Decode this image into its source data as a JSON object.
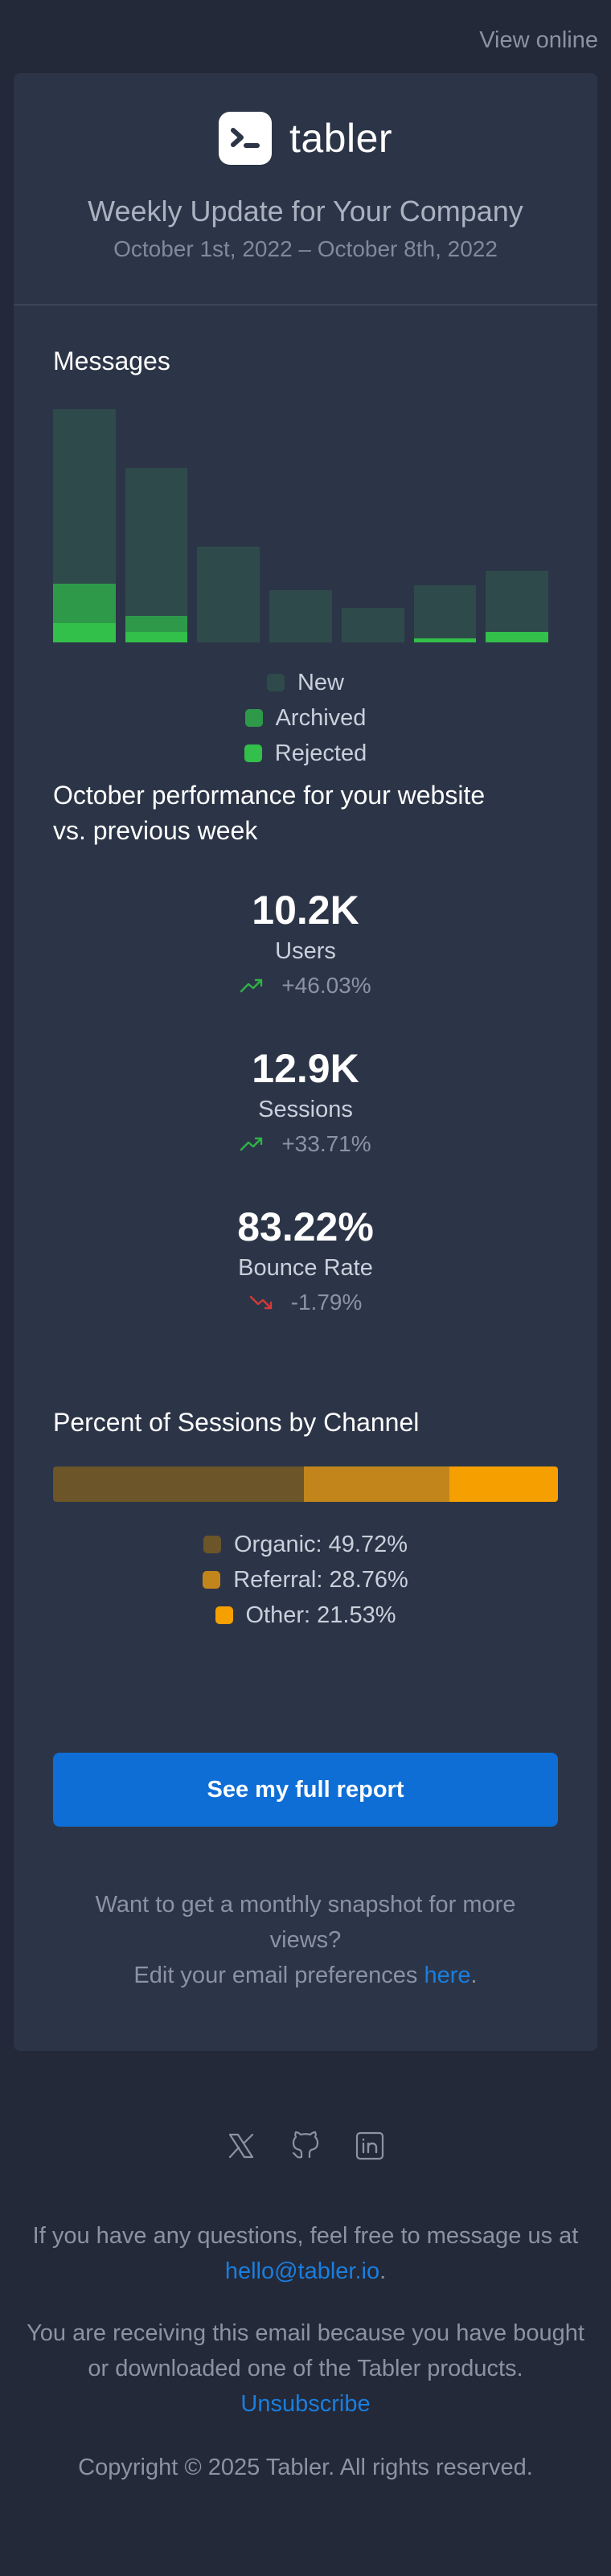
{
  "top": {
    "view_online": "View online"
  },
  "header": {
    "brand": "tabler",
    "title": "Weekly Update for Your Company",
    "date_range": "October 1st, 2022 – October 8th, 2022"
  },
  "messages": {
    "title": "Messages",
    "chart_data": {
      "type": "bar",
      "stacked": true,
      "categories": [
        "1",
        "2",
        "3",
        "4",
        "5",
        "6",
        "7"
      ],
      "series": [
        {
          "name": "New",
          "color": "#2f4a4a",
          "values": [
            200,
            170,
            110,
            60,
            40,
            60,
            70
          ]
        },
        {
          "name": "Archived",
          "color": "#2e9a49",
          "values": [
            45,
            18,
            0,
            0,
            0,
            0,
            0
          ]
        },
        {
          "name": "Rejected",
          "color": "#32bf4a",
          "values": [
            22,
            12,
            0,
            0,
            0,
            5,
            12
          ]
        }
      ]
    },
    "legend": [
      "New",
      "Archived",
      "Rejected"
    ]
  },
  "performance": {
    "title_line1": "October performance for your website",
    "title_line2": "vs. previous week",
    "stats": [
      {
        "value": "10.2K",
        "label": "Users",
        "change": "+46.03%",
        "direction": "up"
      },
      {
        "value": "12.9K",
        "label": "Sessions",
        "change": "+33.71%",
        "direction": "up"
      },
      {
        "value": "83.22%",
        "label": "Bounce Rate",
        "change": "-1.79%",
        "direction": "down"
      }
    ]
  },
  "channels": {
    "title": "Percent of Sessions by Channel",
    "segments": [
      {
        "label": "Organic: 49.72%",
        "percent": 49.72,
        "color": "#6b5529"
      },
      {
        "label": "Referral: 28.76%",
        "percent": 28.76,
        "color": "#c1851b"
      },
      {
        "label": "Other: 21.53%",
        "percent": 21.53,
        "color": "#f59f00"
      }
    ]
  },
  "cta": {
    "label": "See my full report"
  },
  "prefs": {
    "line1": "Want to get a monthly snapshot for more views?",
    "line2_prefix": "Edit your email preferences ",
    "link": "here",
    "line2_suffix": "."
  },
  "footer": {
    "questions_prefix": "If you have any questions, feel free to message us at",
    "email": "hello@tabler.io",
    "email_suffix": ".",
    "receiving": "You are receiving this email because you have bought or downloaded one of the Tabler products.",
    "unsubscribe": "Unsubscribe",
    "copyright": "Copyright © 2025 Tabler. All rights reserved."
  },
  "icons": [
    "x-icon",
    "github-icon",
    "linkedin-icon"
  ],
  "colors": {
    "accent": "#0e6ed6",
    "up": "#2fb344",
    "down": "#d63939"
  }
}
